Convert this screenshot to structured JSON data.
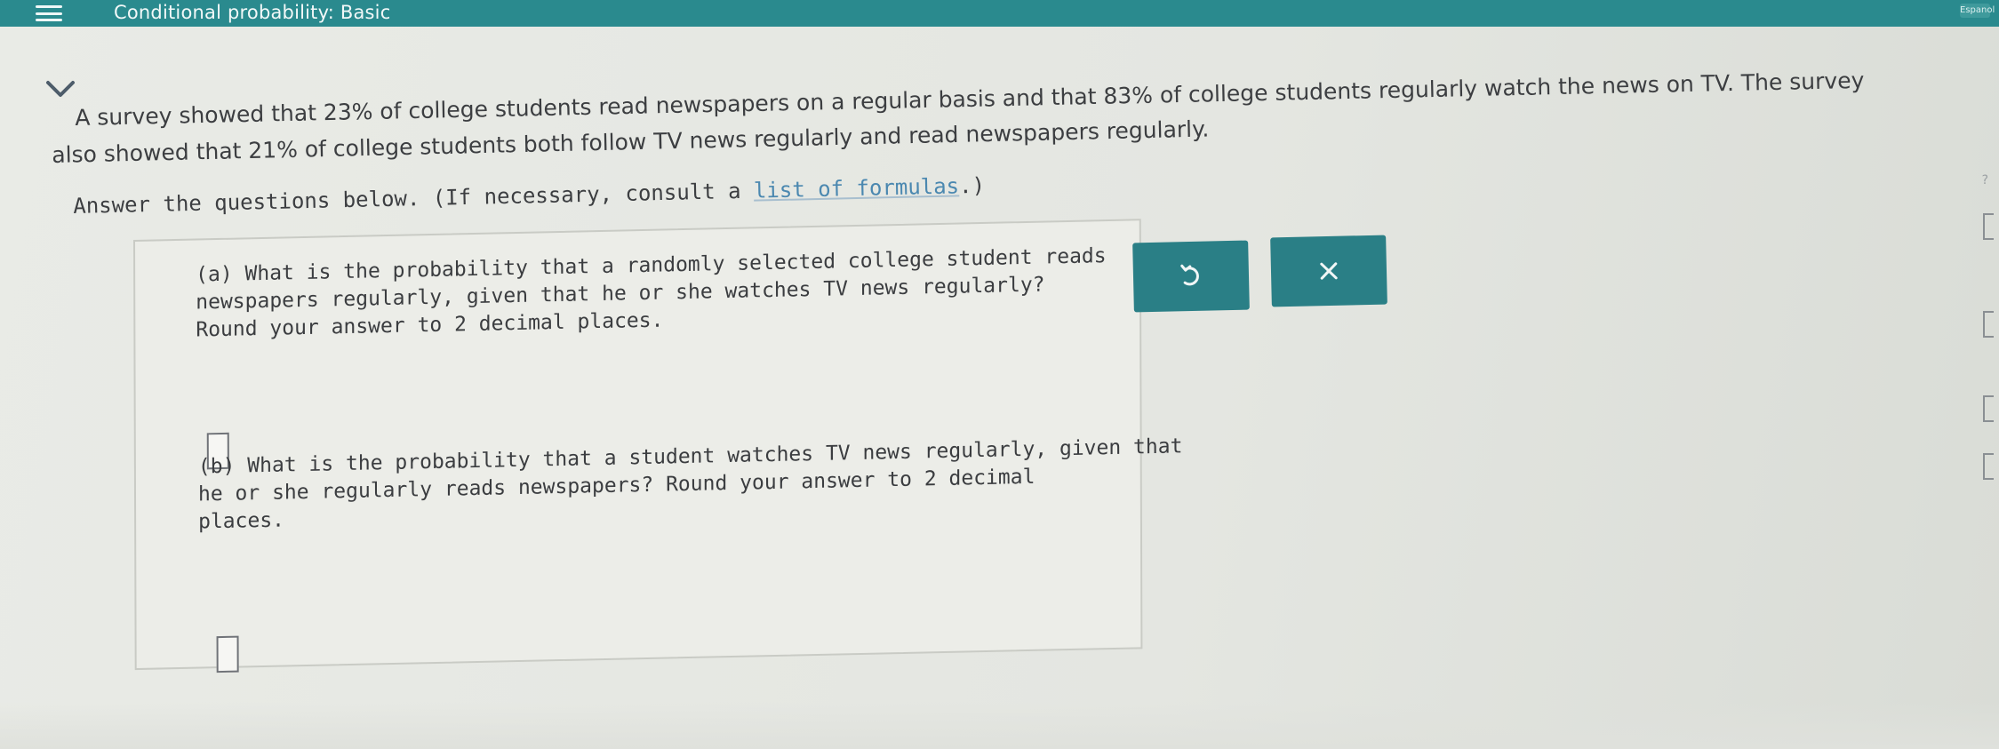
{
  "header": {
    "title": "Conditional probability: Basic",
    "right_label": "Espanol"
  },
  "problem": {
    "line1": "A survey showed that 23% of college students read newspapers on a regular basis and that 83% of college students regularly watch the news on TV. The survey",
    "line2": "also showed that 21% of college students both follow TV news regularly and read newspapers regularly.",
    "line3_prefix": "Answer the questions below. (If necessary, consult a ",
    "line3_link": "list of formulas",
    "line3_suffix": ".)"
  },
  "questions": {
    "a": {
      "line1": "(a) What is the probability that a randomly selected college student reads",
      "line2": "    newspapers regularly, given that he or she watches TV news regularly?",
      "line3": "    Round your answer to 2 decimal places.",
      "answer_value": ""
    },
    "b": {
      "line1": "(b) What is the probability that a student watches TV news regularly, given that",
      "line2": "    he or she regularly reads newspapers? Round your answer to 2 decimal",
      "line3": "    places.",
      "answer_value": ""
    }
  },
  "side": {
    "help_mark": "?"
  },
  "colors": {
    "header_bg": "#2a8a8e",
    "button_bg": "#2a7f86",
    "link": "#4b88b0"
  },
  "icons": {
    "menu": "menu-icon",
    "chevron": "chevron-down-icon",
    "undo": "undo-icon",
    "clear": "close-icon"
  }
}
